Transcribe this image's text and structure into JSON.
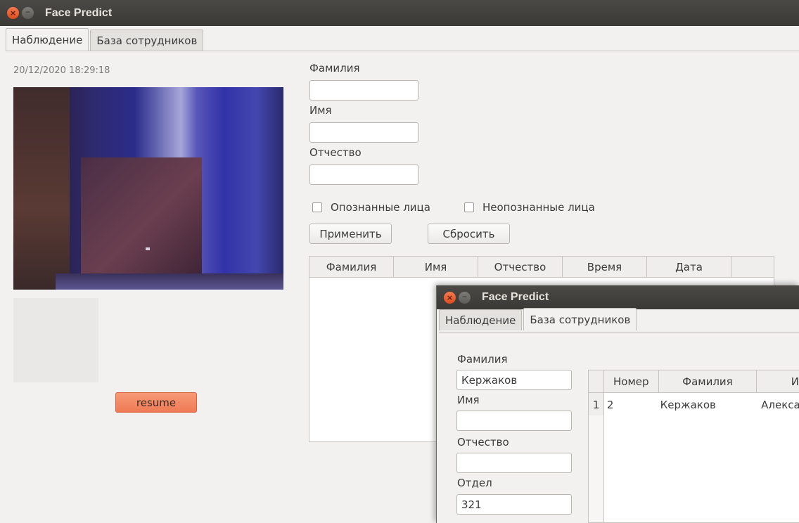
{
  "main_window": {
    "title": "Face Predict",
    "tabs": [
      {
        "label": "Наблюдение"
      },
      {
        "label": "База сотрудников"
      }
    ],
    "timestamp": "20/12/2020 18:29:18",
    "resume_label": "resume",
    "filters": {
      "surname_label": "Фамилия",
      "surname_value": "",
      "name_label": "Имя",
      "name_value": "",
      "patronymic_label": "Отчество",
      "patronymic_value": "",
      "recognized_label": "Опознанные лица",
      "unrecognized_label": "Неопознанные лица",
      "apply_label": "Применить",
      "reset_label": "Сбросить"
    },
    "results_table": {
      "columns": [
        "Фамилия",
        "Имя",
        "Отчество",
        "Время",
        "Дата"
      ]
    }
  },
  "second_window": {
    "title": "Face Predict",
    "tabs": [
      {
        "label": "Наблюдение"
      },
      {
        "label": "База сотрудников"
      }
    ],
    "form": {
      "surname_label": "Фамилия",
      "surname_value": "Кержаков",
      "name_label": "Имя",
      "name_value": "",
      "patronymic_label": "Отчество",
      "patronymic_value": "",
      "department_label": "Отдел",
      "department_value": "321"
    },
    "employees_table": {
      "columns": [
        "Номер",
        "Фамилия",
        "И"
      ],
      "rows": [
        {
          "row_number": "1",
          "number": "2",
          "surname": "Кержаков",
          "name": "Алекса"
        }
      ]
    }
  },
  "colors": {
    "titlebar": "#3c3b37",
    "close_button": "#e9541f",
    "resume_button": "#f38a63",
    "window_bg": "#f2f1f0"
  },
  "icons": {
    "close": "close-icon",
    "minimize": "minimize-icon"
  }
}
